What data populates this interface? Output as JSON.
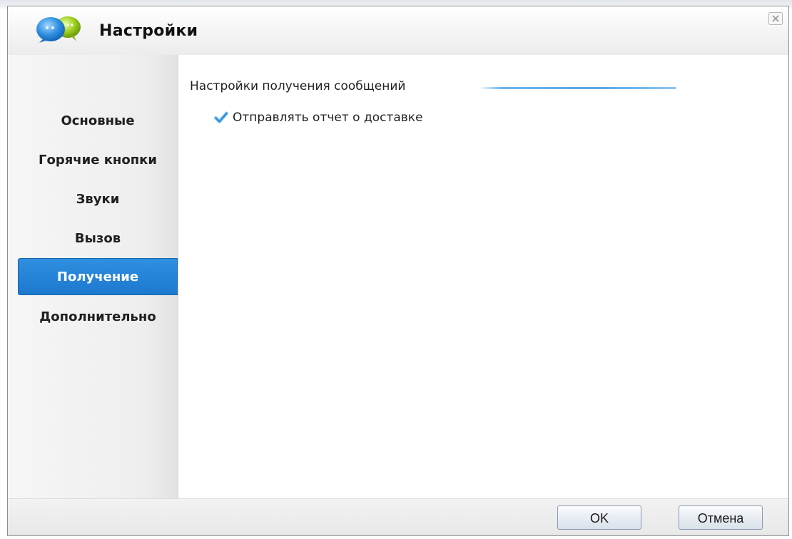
{
  "window": {
    "title": "Настройки",
    "app_icon": "chat-bubbles-icon",
    "close_icon": "close-icon"
  },
  "sidebar": {
    "items": [
      {
        "label": "Основные",
        "active": false
      },
      {
        "label": "Горячие кнопки",
        "active": false
      },
      {
        "label": "Звуки",
        "active": false
      },
      {
        "label": "Вызов",
        "active": false
      },
      {
        "label": "Получение",
        "active": true
      },
      {
        "label": "Дополнительно",
        "active": false
      }
    ]
  },
  "content": {
    "section_title": "Настройки получения сообщений",
    "checkbox": {
      "label": "Отправлять отчет о доставке",
      "checked": true
    }
  },
  "footer": {
    "ok_label": "OK",
    "cancel_label": "Отмена"
  },
  "colors": {
    "accent": "#1d79cf",
    "section_line": "#5aa8e6",
    "checkmark": "#2f8fe0"
  }
}
